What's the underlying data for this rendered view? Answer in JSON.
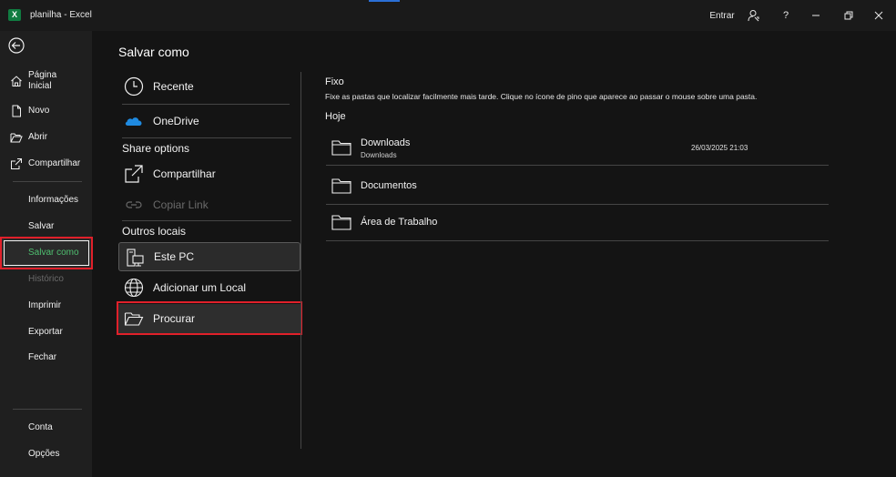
{
  "window": {
    "file_name": "planilha",
    "separator": "-",
    "app_name": "Excel",
    "sign_in": "Entrar",
    "accent_color": "#107c41"
  },
  "nav": {
    "items": [
      {
        "label": "Página\nInicial",
        "icon": "home-icon"
      },
      {
        "label": "Novo",
        "icon": "new-document-icon"
      },
      {
        "label": "Abrir",
        "icon": "open-folder-icon"
      },
      {
        "label": "Compartilhar",
        "icon": "share-icon"
      },
      {
        "label": "Informações"
      },
      {
        "label": "Salvar"
      },
      {
        "label": "Salvar como",
        "active": true
      },
      {
        "label": "Histórico",
        "disabled": true
      },
      {
        "label": "Imprimir"
      },
      {
        "label": "Exportar"
      },
      {
        "label": "Fechar"
      },
      {
        "label": "Conta"
      },
      {
        "label": "Opções"
      }
    ]
  },
  "page_title": "Salvar como",
  "locations": {
    "recent": "Recente",
    "onedrive": "OneDrive",
    "share_options_header": "Share options",
    "share": "Compartilhar",
    "copy_link": "Copiar Link",
    "other_locations_header": "Outros locais",
    "this_pc": "Este PC",
    "add_place": "Adicionar um Local",
    "browse": "Procurar"
  },
  "pinned": {
    "title": "Fixo",
    "description": "Fixe as pastas que localizar facilmente mais tarde. Clique no ícone de pino que aparece ao passar o mouse sobre uma pasta."
  },
  "today": {
    "title": "Hoje",
    "folders": [
      {
        "name": "Downloads",
        "path": "Downloads",
        "date": "26/03/2025 21:03"
      },
      {
        "name": "Documentos"
      },
      {
        "name": "Área de Trabalho"
      }
    ]
  }
}
